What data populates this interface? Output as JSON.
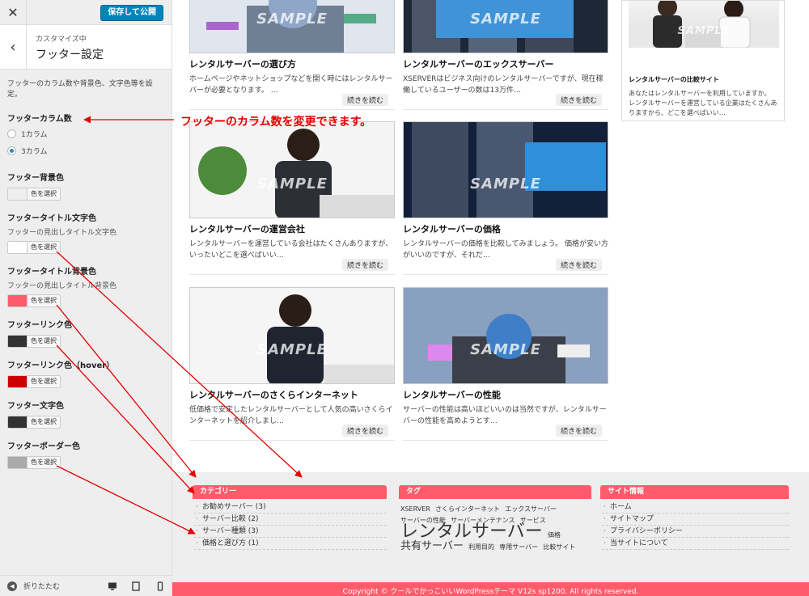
{
  "customizer": {
    "close_label": "✕",
    "save_label": "保存して公開",
    "breadcrumb": "カスタマイズ中",
    "section_title": "フッター設定",
    "description": "フッターのカラム数や背景色、文字色等を設定。",
    "column_count": {
      "label": "フッターカラム数",
      "options": [
        {
          "label": "1カラム",
          "checked": false
        },
        {
          "label": "3カラム",
          "checked": true
        }
      ]
    },
    "colors": [
      {
        "label": "フッター背景色",
        "sub": "",
        "swatch": "#eeeeee",
        "button": "色を選択"
      },
      {
        "label": "フッタータイトル文字色",
        "sub": "フッターの見出しタイトル文字色",
        "swatch": "#ffffff",
        "button": "色を選択"
      },
      {
        "label": "フッタータイトル背景色",
        "sub": "フッターの見出しタイトル背景色",
        "swatch": "#ff5b6b",
        "button": "色を選択"
      },
      {
        "label": "フッターリンク色",
        "sub": "",
        "swatch": "#333333",
        "button": "色を選択"
      },
      {
        "label": "フッターリンク色（hover）",
        "sub": "",
        "swatch": "#cc0000",
        "button": "色を選択"
      },
      {
        "label": "フッター文字色",
        "sub": "",
        "swatch": "#333333",
        "button": "色を選択"
      },
      {
        "label": "フッターボーダー色",
        "sub": "",
        "swatch": "#aaaaaa",
        "button": "色を選択"
      }
    ],
    "collapse_label": "折りたたむ"
  },
  "annotation": "フッターのカラム数を変更できます。",
  "sample_watermark": "SAMPLE",
  "cards": [
    {
      "title": "レンタルサーバーの選び方",
      "excerpt": "ホームページやネットショップなどを開く時にはレンタルサーバーが必要となります。 …",
      "more": "続きを読む"
    },
    {
      "title": "レンタルサーバーのエックスサーバー",
      "excerpt": "XSERVERはビジネス向けのレンタルサーバーですが、現在稼働しているユーザーの数は13万件…",
      "more": "続きを読む"
    },
    {
      "title": "レンタルサーバーの運営会社",
      "excerpt": "レンタルサーバーを運営している会社はたくさんありますが、いったいどこを選べばいい…",
      "more": "続きを読む"
    },
    {
      "title": "レンタルサーバーの価格",
      "excerpt": "レンタルサーバーの価格を比較してみましょう。 価格が安い方がいいのですが、それだ…",
      "more": "続きを読む"
    },
    {
      "title": "レンタルサーバーのさくらインターネット",
      "excerpt": "低価格で安定したレンタルサーバーとして人気の高いさくらインターネットを紹介しまし…",
      "more": "続きを読む"
    },
    {
      "title": "レンタルサーバーの性能",
      "excerpt": "サーバーの性能は高いほどいいのは当然ですが、レンタルサーバーの性能を高めようとす…",
      "more": "続きを読む"
    }
  ],
  "side_card": {
    "title": "レンタルサーバーの比較サイト",
    "excerpt": "あなたはレンタルサーバーを利用していますか。 レンタルサーバーを運営している企業はたくさんありますから、どこを選べばいい…"
  },
  "footer": {
    "categories": {
      "title": "カテゴリー",
      "items": [
        "お勧めサーバー (3)",
        "サーバー比較 (2)",
        "サーバー種類 (3)",
        "価格と選び方 (1)"
      ]
    },
    "tags": {
      "title": "タグ",
      "items": [
        {
          "text": "XSERVER",
          "size": 8
        },
        {
          "text": "さくらインターネット",
          "size": 8
        },
        {
          "text": "エックスサーバー",
          "size": 8
        },
        {
          "text": "サーバーの性能",
          "size": 8
        },
        {
          "text": "サーバーメンテナンス",
          "size": 8
        },
        {
          "text": "サービス",
          "size": 8
        },
        {
          "text": "レンタルサーバー",
          "size": 22
        },
        {
          "text": "価格",
          "size": 8
        },
        {
          "text": "共有サーバー",
          "size": 13
        },
        {
          "text": "利用目的",
          "size": 8
        },
        {
          "text": "専用サーバー",
          "size": 8
        },
        {
          "text": "比較サイト",
          "size": 8
        }
      ]
    },
    "site_info": {
      "title": "サイト情報",
      "items": [
        "ホーム",
        "サイトマップ",
        "プライバシーポリシー",
        "当サイトについて"
      ]
    },
    "copyright": "Copyright © クールでかっこいいWordPressテーマ V12s sp1200. All rights reserved."
  }
}
